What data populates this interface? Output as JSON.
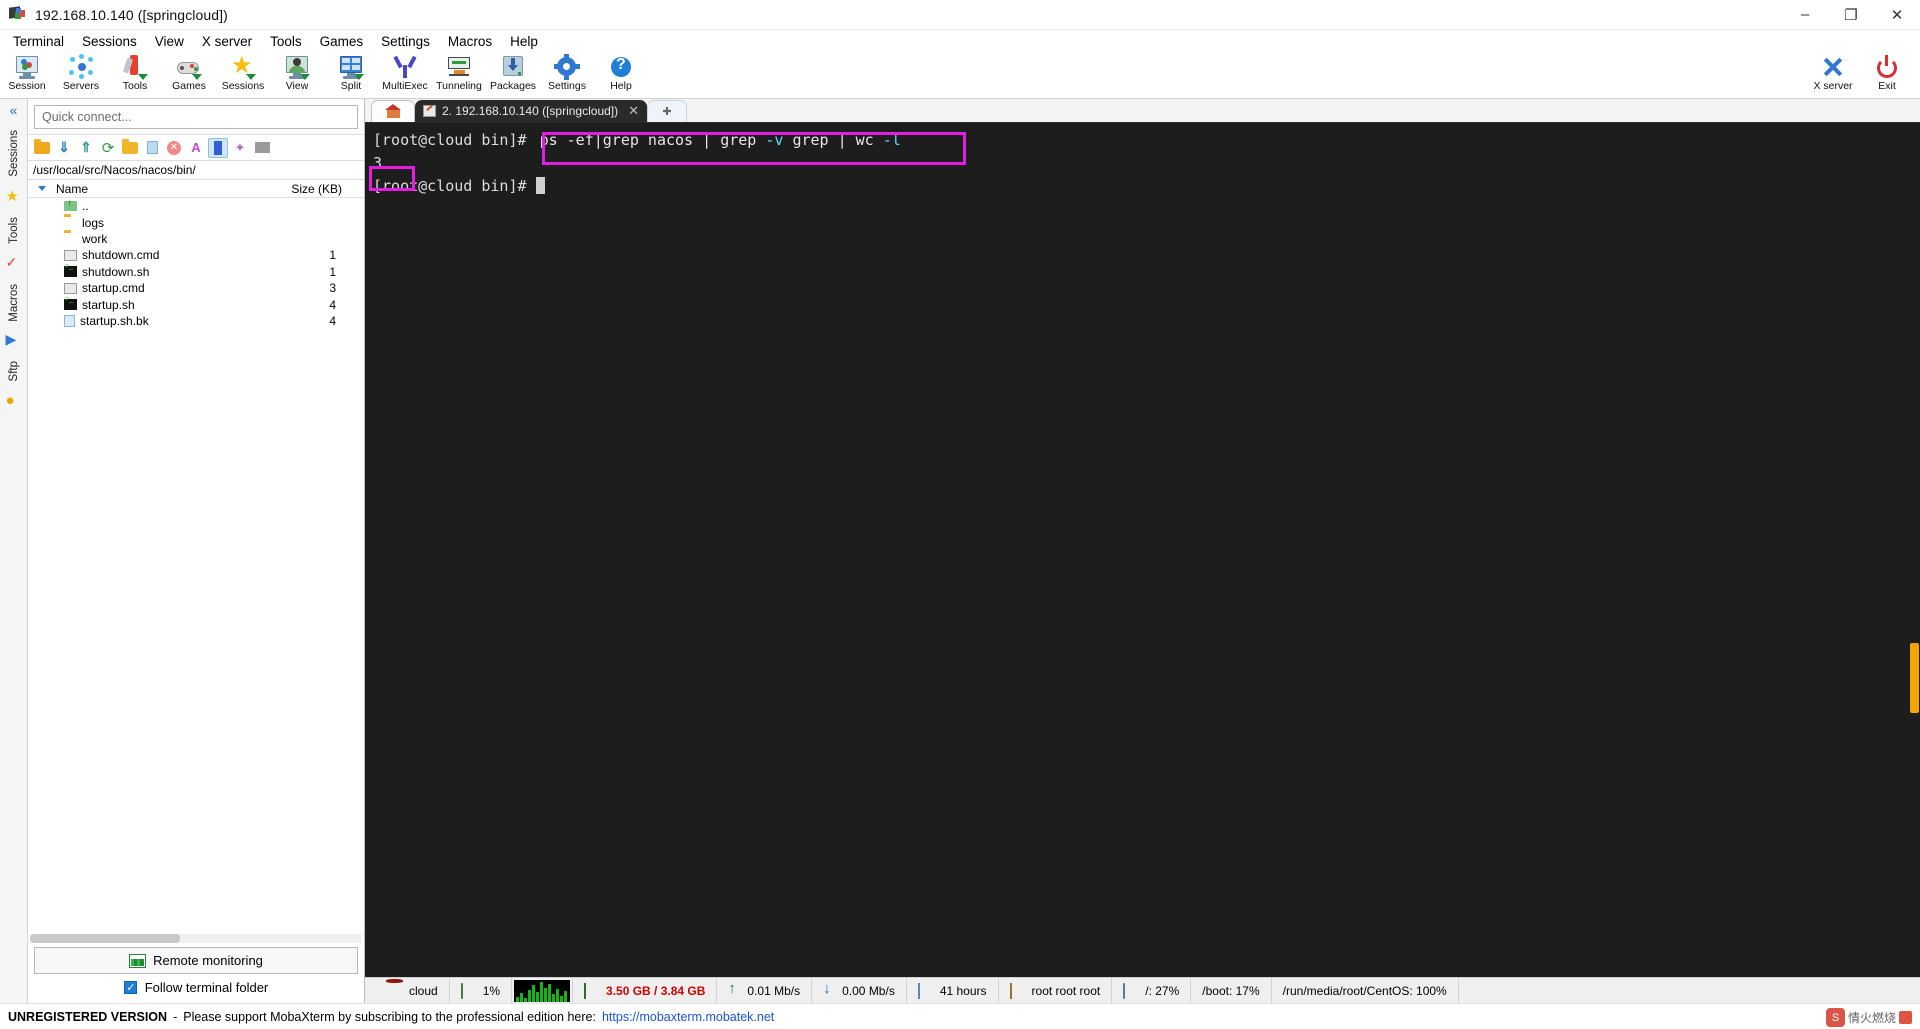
{
  "window": {
    "title": "192.168.10.140 ([springcloud])",
    "minimize": "–",
    "maximize": "❐",
    "close": "✕"
  },
  "menu": {
    "items": [
      "Terminal",
      "Sessions",
      "View",
      "X server",
      "Tools",
      "Games",
      "Settings",
      "Macros",
      "Help"
    ]
  },
  "toolbar": {
    "left": [
      {
        "label": "Session",
        "icon": "session-icon"
      },
      {
        "label": "Servers",
        "icon": "servers-icon"
      },
      {
        "label": "Tools",
        "icon": "tools-icon"
      },
      {
        "label": "Games",
        "icon": "games-icon"
      },
      {
        "label": "Sessions",
        "icon": "sessions-star-icon"
      },
      {
        "label": "View",
        "icon": "view-icon"
      },
      {
        "label": "Split",
        "icon": "split-icon"
      },
      {
        "label": "MultiExec",
        "icon": "multiexec-icon"
      },
      {
        "label": "Tunneling",
        "icon": "tunneling-icon"
      },
      {
        "label": "Packages",
        "icon": "packages-icon"
      },
      {
        "label": "Settings",
        "icon": "settings-icon"
      },
      {
        "label": "Help",
        "icon": "help-icon"
      }
    ],
    "right": [
      {
        "label": "X server",
        "icon": "xserver-icon"
      },
      {
        "label": "Exit",
        "icon": "exit-icon"
      }
    ]
  },
  "sidebar_strip": {
    "collapse": "«",
    "tabs": [
      "Sessions",
      "Tools",
      "Macros",
      "Sftp"
    ]
  },
  "sftp": {
    "quick_connect_placeholder": "Quick connect...",
    "path": "/usr/local/src/Nacos/nacos/bin/",
    "status_ok": "✓",
    "columns": {
      "name": "Name",
      "size": "Size (KB)"
    },
    "files": [
      {
        "name": "..",
        "size": "",
        "icon": "parent-folder-icon"
      },
      {
        "name": "logs",
        "size": "",
        "icon": "folder-icon"
      },
      {
        "name": "work",
        "size": "",
        "icon": "folder-icon"
      },
      {
        "name": "shutdown.cmd",
        "size": "1",
        "icon": "cmd-file-icon"
      },
      {
        "name": "shutdown.sh",
        "size": "1",
        "icon": "shell-file-icon"
      },
      {
        "name": "startup.cmd",
        "size": "3",
        "icon": "cmd-file-icon"
      },
      {
        "name": "startup.sh",
        "size": "4",
        "icon": "shell-file-icon"
      },
      {
        "name": "startup.sh.bk",
        "size": "4",
        "icon": "text-file-icon"
      }
    ],
    "remote_monitoring": "Remote monitoring",
    "follow_terminal_folder": "Follow terminal folder"
  },
  "tabs": {
    "home_icon": "home-icon",
    "active": "2. 192.168.10.140 ([springcloud])",
    "close_glyph": "✕",
    "new_tab_glyph": "➕"
  },
  "terminal": {
    "prompt1": "[root@cloud bin]# ",
    "command_parts": [
      {
        "text": "ps -ef|grep nacos | ",
        "color": "white"
      },
      {
        "text": "grep ",
        "color": "white"
      },
      {
        "text": "-v ",
        "color": "cyan"
      },
      {
        "text": "grep | ",
        "color": "white"
      },
      {
        "text": "wc ",
        "color": "white"
      },
      {
        "text": "-l",
        "color": "cyan"
      }
    ],
    "command_plain": "ps -ef|grep nacos | grep -v grep | wc -l",
    "output": "3",
    "prompt2": "[root@cloud bin]# ",
    "highlight_color": "#e41ee0"
  },
  "statusbar": {
    "items": [
      {
        "icon": "redhat-icon",
        "label": "cloud"
      },
      {
        "icon": "cpu-icon",
        "label": "1%"
      },
      {
        "icon": "graph-icon",
        "label": ""
      },
      {
        "icon": "ram-icon",
        "label": "3.50 GB / 3.84 GB",
        "color": "#d00000"
      },
      {
        "icon": "upload-icon",
        "label": "0.01 Mb/s"
      },
      {
        "icon": "download-icon",
        "label": "0.00 Mb/s"
      },
      {
        "icon": "uptime-icon",
        "label": "41 hours"
      },
      {
        "icon": "user-icon",
        "label": "root  root  root"
      },
      {
        "icon": "disk-icon",
        "label": "/: 27%"
      },
      {
        "icon": "",
        "label": "/boot: 17%"
      },
      {
        "icon": "",
        "label": "/run/media/root/CentOS: 100%"
      }
    ]
  },
  "footer": {
    "unregistered": "UNREGISTERED VERSION",
    "dash": "-",
    "message": "Please support MobaXterm by subscribing to the professional edition here:",
    "link": "https://mobaxterm.mobatek.net",
    "watermark": "情火燃烧"
  }
}
